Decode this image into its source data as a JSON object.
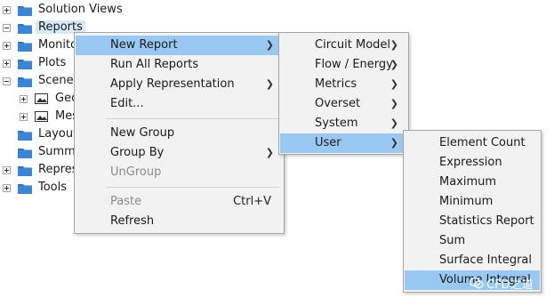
{
  "tree": {
    "items": [
      {
        "label": "Solution Views",
        "expander": "plus"
      },
      {
        "label": "Reports",
        "expander": "minus",
        "selected": true
      },
      {
        "label": "Monitors",
        "expander": "plus"
      },
      {
        "label": "Plots",
        "expander": "plus"
      },
      {
        "label": "Scenes",
        "expander": "minus"
      },
      {
        "label": "Geometry",
        "expander": "plus",
        "child": true
      },
      {
        "label": "Mesh",
        "expander": "plus",
        "child": true
      },
      {
        "label": "Layouts",
        "expander": "none"
      },
      {
        "label": "Summaries",
        "expander": "none"
      },
      {
        "label": "Representations",
        "expander": "plus"
      },
      {
        "label": "Tools",
        "expander": "plus"
      }
    ]
  },
  "context_menu": {
    "items": [
      {
        "label": "New Report",
        "submenu": true,
        "highlighted": true
      },
      {
        "label": "Run All Reports"
      },
      {
        "label": "Apply Representation",
        "submenu": true
      },
      {
        "label": "Edit..."
      },
      {
        "label": "New Group"
      },
      {
        "label": "Group By",
        "submenu": true
      },
      {
        "label": "UnGroup",
        "disabled": true
      },
      {
        "label": "Paste",
        "shortcut": "Ctrl+V",
        "disabled": true
      },
      {
        "label": "Refresh"
      }
    ]
  },
  "new_report_menu": {
    "items": [
      {
        "label": "Circuit Model",
        "submenu": true
      },
      {
        "label": "Flow / Energy",
        "submenu": true
      },
      {
        "label": "Metrics",
        "submenu": true
      },
      {
        "label": "Overset",
        "submenu": true
      },
      {
        "label": "System",
        "submenu": true
      },
      {
        "label": "User",
        "submenu": true,
        "highlighted": true
      }
    ]
  },
  "user_menu": {
    "items": [
      {
        "label": "Element Count"
      },
      {
        "label": "Expression"
      },
      {
        "label": "Maximum"
      },
      {
        "label": "Minimum"
      },
      {
        "label": "Statistics Report"
      },
      {
        "label": "Sum"
      },
      {
        "label": "Surface Integral"
      },
      {
        "label": "Volume Integral",
        "highlighted": true
      }
    ]
  },
  "watermark": {
    "text": "CFD之道"
  },
  "colors": {
    "highlight": "#99c9f2",
    "folder": "#2f74c0",
    "menu_bg": "#f2f2f2"
  }
}
